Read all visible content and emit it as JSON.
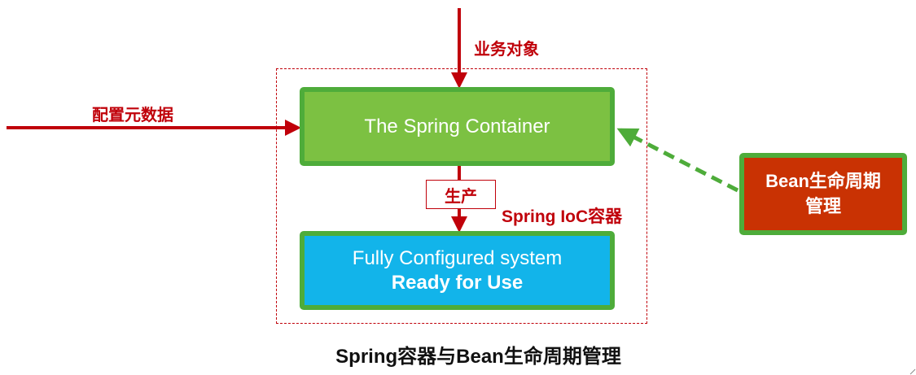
{
  "labels": {
    "business_object": "业务对象",
    "config_metadata": "配置元数据",
    "produce": "生产",
    "ioc_container": "Spring IoC容器"
  },
  "boxes": {
    "spring_container": "The Spring Container",
    "system_line1": "Fully Configured system",
    "system_line2": "Ready for Use",
    "bean_line1": "Bean生命周期",
    "bean_line2": "管理"
  },
  "caption": "Spring容器与Bean生命周期管理",
  "colors": {
    "arrow_red": "#c0000a",
    "container_green": "#7cc142",
    "border_green": "#4eac3a",
    "system_blue": "#12b4ea",
    "bean_red": "#c93203"
  }
}
